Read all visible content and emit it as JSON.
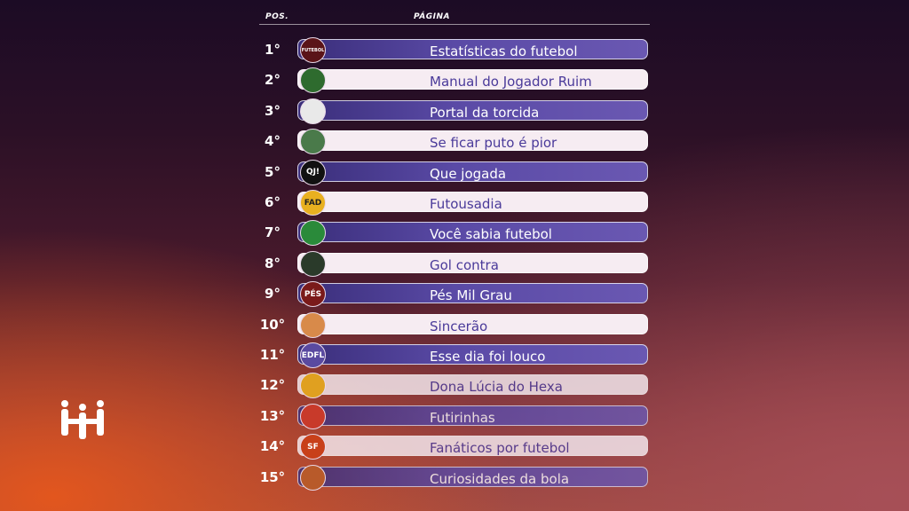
{
  "header": {
    "pos_label": "POS.",
    "page_label": "PÁGINA"
  },
  "rows": [
    {
      "pos": "1°",
      "name": "Estatísticas do futebol",
      "style": "dark",
      "avatar_icon": "football-crest-icon",
      "avatar_text": "FUTEBOL",
      "avatar_color": "#5a1418"
    },
    {
      "pos": "2°",
      "name": "Manual do Jogador Ruim",
      "style": "light",
      "avatar_icon": "person-portrait-icon",
      "avatar_text": "",
      "avatar_color": "#2e6b2e"
    },
    {
      "pos": "3°",
      "name": "Portal da torcida",
      "style": "dark",
      "avatar_icon": "laurel-ball-icon",
      "avatar_text": "",
      "avatar_color": "#e9e9e9"
    },
    {
      "pos": "4°",
      "name": "Se ficar puto é pior",
      "style": "light",
      "avatar_icon": "person-portrait-icon",
      "avatar_text": "",
      "avatar_color": "#4a7a4a"
    },
    {
      "pos": "5°",
      "name": "Que jogada",
      "style": "dark",
      "avatar_icon": "qj-logo-icon",
      "avatar_text": "QJ!",
      "avatar_color": "#111111"
    },
    {
      "pos": "6°",
      "name": "Futousadia",
      "style": "light",
      "avatar_icon": "shield-crest-icon",
      "avatar_text": "FAD",
      "avatar_color": "#e8b020"
    },
    {
      "pos": "7°",
      "name": "Você sabia futebol",
      "style": "dark",
      "avatar_icon": "soccer-ball-icon",
      "avatar_text": "",
      "avatar_color": "#2a8a3a"
    },
    {
      "pos": "8°",
      "name": "Gol contra",
      "style": "light",
      "avatar_icon": "player-silhouette-icon",
      "avatar_text": "",
      "avatar_color": "#2a3a2a"
    },
    {
      "pos": "9°",
      "name": "Pés Mil Grau",
      "style": "dark",
      "avatar_icon": "pes-logo-icon",
      "avatar_text": "PÉS",
      "avatar_color": "#7a1a1a"
    },
    {
      "pos": "10°",
      "name": "Sincerão",
      "style": "light",
      "avatar_icon": "sunglasses-face-icon",
      "avatar_text": "",
      "avatar_color": "#d88a4a"
    },
    {
      "pos": "11°",
      "name": "Esse dia foi louco",
      "style": "dark",
      "avatar_icon": "edfl-logo-icon",
      "avatar_text": "EDFL",
      "avatar_color": "#5a4aa0"
    },
    {
      "pos": "12°",
      "name": "Dona Lúcia do Hexa",
      "style": "light",
      "avatar_icon": "woman-portrait-icon",
      "avatar_text": "",
      "avatar_color": "#e0a020"
    },
    {
      "pos": "13°",
      "name": "Futirinhas",
      "style": "dark",
      "avatar_icon": "comic-ball-icon",
      "avatar_text": "",
      "avatar_color": "#c83a2a"
    },
    {
      "pos": "14°",
      "name": "Fanáticos por futebol",
      "style": "light",
      "avatar_icon": "sf-logo-icon",
      "avatar_text": "SF",
      "avatar_color": "#c8401a"
    },
    {
      "pos": "15°",
      "name": "Curiosidades da bola",
      "style": "dark",
      "avatar_icon": "badge-ball-icon",
      "avatar_text": "",
      "avatar_color": "#b85a2a"
    }
  ],
  "colors": {
    "pill_dark": "#5a4aa6",
    "pill_light": "#f6ecf2",
    "text_light_pill": "#4a3a9a",
    "background_orange": "#e2561e",
    "background_dark": "#1c0b25"
  },
  "brand_logo_icon": "brand-people-logo-icon"
}
